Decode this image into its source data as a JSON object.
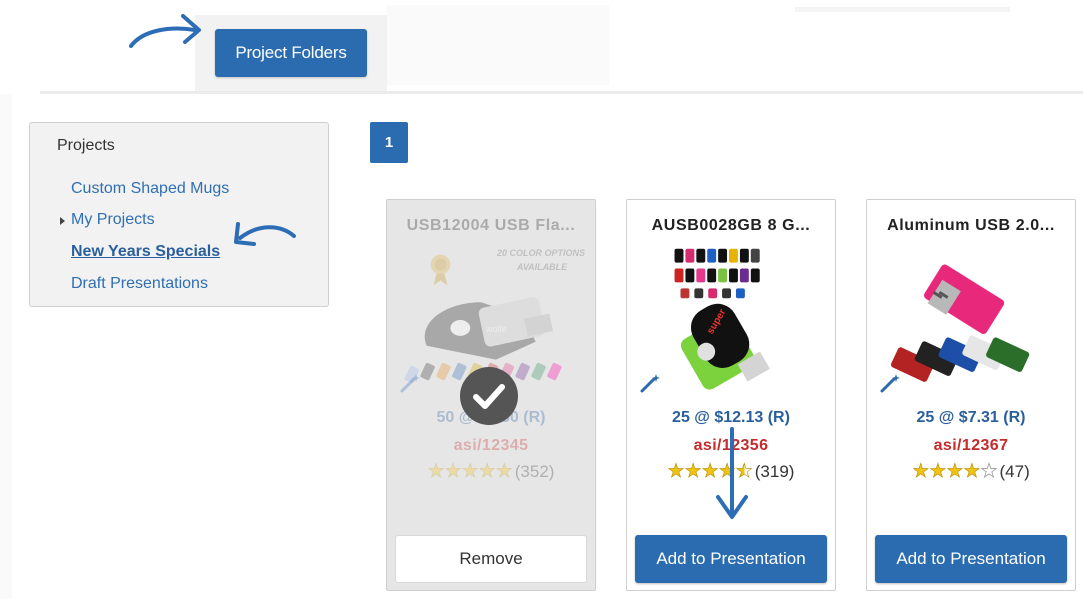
{
  "toolbar": {
    "project_folders_label": "Project Folders"
  },
  "projects_panel": {
    "title": "Projects",
    "items": [
      {
        "label": "Custom Shaped Mugs"
      },
      {
        "label": "My Projects"
      },
      {
        "label": "New Years Specials"
      },
      {
        "label": "Draft Presentations"
      }
    ]
  },
  "pagination": {
    "current_page": "1"
  },
  "products": [
    {
      "title": "USB12004 USB Fla...",
      "image_text_1": "20 COLOR OPTIONS",
      "image_text_2": "AVAILABLE",
      "price": "50 @ $5.50 (R)",
      "asi": "asi/12345",
      "rating": 5,
      "reviews": "(352)",
      "button_label": "Remove",
      "selected": true
    },
    {
      "title": "AUSB0028GB 8 G...",
      "price": "25 @ $12.13 (R)",
      "asi": "asi/12356",
      "rating": 4.5,
      "reviews": "(319)",
      "button_label": "Add to Presentation",
      "selected": false
    },
    {
      "title": "Aluminum USB 2.0...",
      "price": "25 @ $7.31 (R)",
      "asi": "asi/12367",
      "rating": 4,
      "reviews": "(47)",
      "button_label": "Add to Presentation",
      "selected": false
    }
  ],
  "colors": {
    "accent": "#2b6cb0",
    "link": "#2f6fb2",
    "asi_red": "#c42b2b",
    "annotation_arrow": "#2d6db5"
  }
}
